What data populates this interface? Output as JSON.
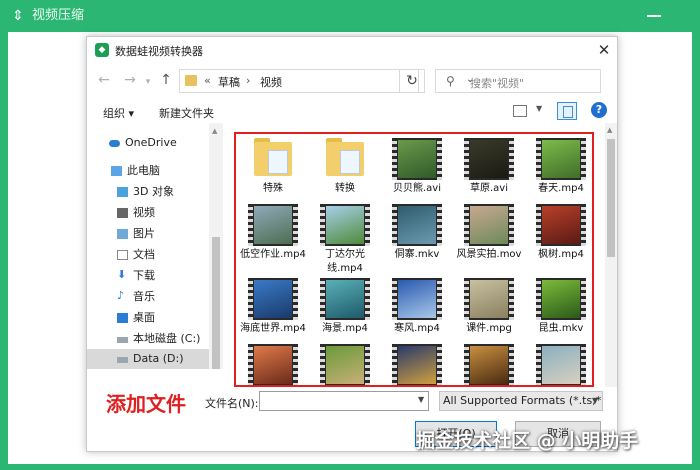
{
  "app": {
    "title": "视频压缩",
    "accent_color": "#2bb673",
    "title_icon": "compress-icon"
  },
  "dialog": {
    "title": "数据蛙视频转换器",
    "close_icon": "close-icon",
    "address": {
      "prefix": "«",
      "crumbs": [
        "草稿",
        "视频"
      ],
      "sep": "›"
    },
    "search_placeholder": "搜索\"视频\"",
    "toolbar": {
      "organize": "组织 ▾",
      "new_folder": "新建文件夹"
    },
    "sidebar": {
      "items": [
        {
          "label": "OneDrive",
          "icon": "cloud-icon"
        },
        {
          "label": "此电脑",
          "icon": "computer-icon"
        },
        {
          "label": "3D 对象",
          "icon": "3d-objects-icon"
        },
        {
          "label": "视频",
          "icon": "videos-icon"
        },
        {
          "label": "图片",
          "icon": "pictures-icon"
        },
        {
          "label": "文档",
          "icon": "documents-icon"
        },
        {
          "label": "下载",
          "icon": "download-icon"
        },
        {
          "label": "音乐",
          "icon": "music-icon"
        },
        {
          "label": "桌面",
          "icon": "desktop-icon"
        },
        {
          "label": "本地磁盘 (C:)",
          "icon": "drive-icon"
        },
        {
          "label": "Data (D:)",
          "icon": "drive-icon"
        }
      ]
    },
    "files": [
      {
        "name": "特殊",
        "kind": "folder"
      },
      {
        "name": "转换",
        "kind": "folder"
      },
      {
        "name": "贝贝熊.avi",
        "kind": "video"
      },
      {
        "name": "草原.avi",
        "kind": "video"
      },
      {
        "name": "春天.mp4",
        "kind": "video"
      },
      {
        "name": "低空作业.mp4",
        "kind": "video"
      },
      {
        "name": "丁达尔光线.mp4",
        "kind": "video"
      },
      {
        "name": "侗寨.mkv",
        "kind": "video"
      },
      {
        "name": "风景实拍.mov",
        "kind": "video"
      },
      {
        "name": "枫树.mp4",
        "kind": "video"
      },
      {
        "name": "海底世界.mp4",
        "kind": "video"
      },
      {
        "name": "海景.mp4",
        "kind": "video"
      },
      {
        "name": "寒风.mp4",
        "kind": "video"
      },
      {
        "name": "课件.mpg",
        "kind": "video"
      },
      {
        "name": "昆虫.mkv",
        "kind": "video"
      },
      {
        "name": "",
        "kind": "video"
      },
      {
        "name": "",
        "kind": "video"
      },
      {
        "name": "",
        "kind": "video"
      },
      {
        "name": "",
        "kind": "video"
      },
      {
        "name": "",
        "kind": "video"
      }
    ],
    "filename_label": "文件名(N):",
    "filename_value": "",
    "format": "All Supported Formats (*.ts;*",
    "open_label": "打开(O)",
    "cancel_label": "取消"
  },
  "annotation": {
    "add_file": "添加文件",
    "color": "#e02020"
  },
  "watermark": "掘金技术社区 @ 小明助手"
}
